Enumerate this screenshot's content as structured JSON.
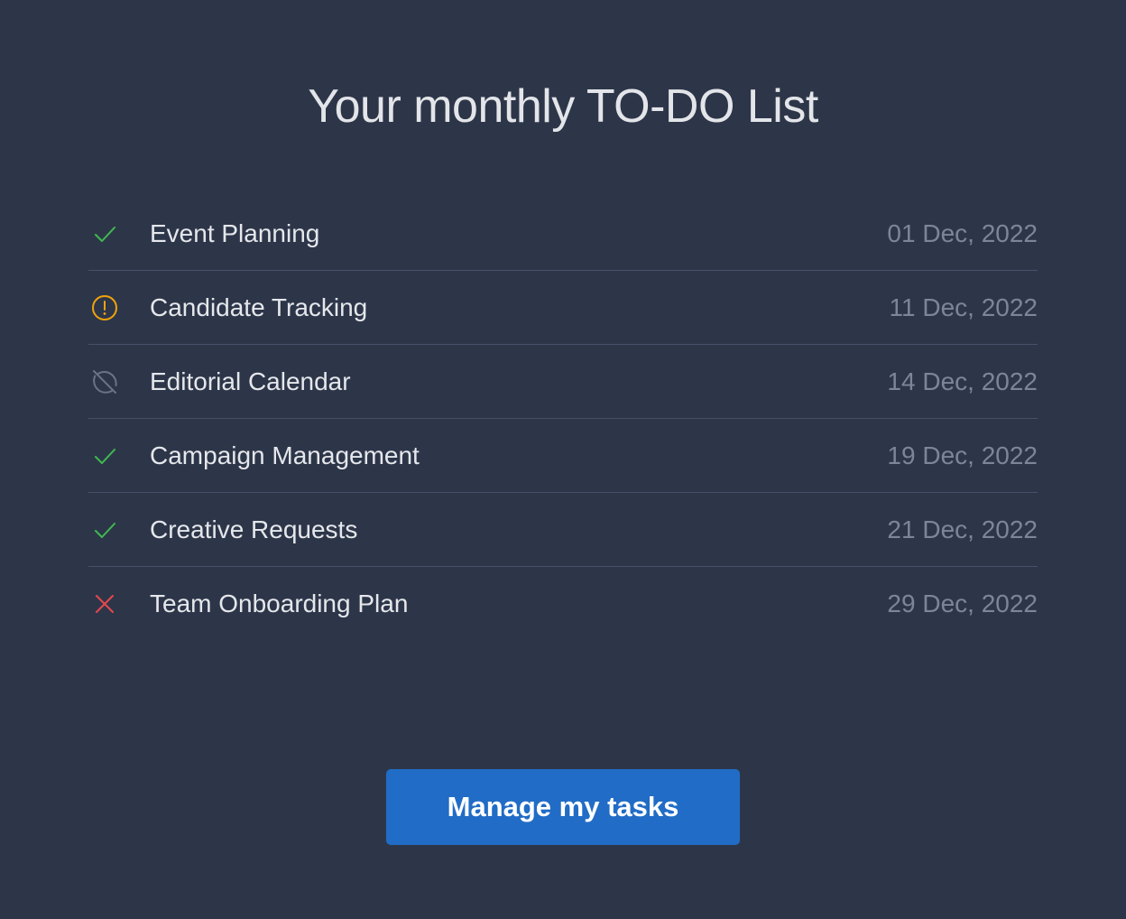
{
  "title": "Your monthly TO-DO List",
  "tasks": [
    {
      "name": "Event Planning",
      "date": "01 Dec, 2022",
      "status": "done",
      "icon": "check-icon"
    },
    {
      "name": "Candidate Tracking",
      "date": "11 Dec, 2022",
      "status": "warning",
      "icon": "alert-circle-icon"
    },
    {
      "name": "Editorial Calendar",
      "date": "14 Dec, 2022",
      "status": "disabled",
      "icon": "blocked-circle-icon"
    },
    {
      "name": "Campaign Management",
      "date": "19 Dec, 2022",
      "status": "done",
      "icon": "check-icon"
    },
    {
      "name": "Creative Requests",
      "date": "21 Dec, 2022",
      "status": "done",
      "icon": "check-icon"
    },
    {
      "name": "Team Onboarding Plan",
      "date": "29 Dec, 2022",
      "status": "failed",
      "icon": "x-icon"
    }
  ],
  "button": {
    "label": "Manage my tasks"
  },
  "colors": {
    "background": "#2d3649",
    "done": "#3fb950",
    "warning": "#f0a30a",
    "disabled": "#6b7385",
    "failed": "#e5484d",
    "accent": "#216cc6"
  }
}
